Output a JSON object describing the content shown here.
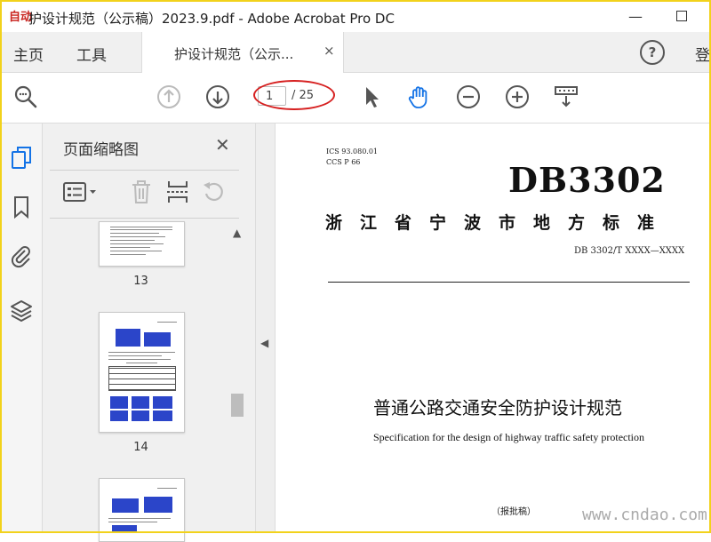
{
  "window": {
    "app_logo": "自动",
    "title": "护设计规范（公示稿）2023.9.pdf - Adobe Acrobat Pro DC",
    "minimize": "—"
  },
  "menu": {
    "home": "主页",
    "tools": "工具",
    "doc_tab": "护设计规范（公示...",
    "doc_tab_close": "×",
    "help": "?",
    "signin": "登"
  },
  "toolbar": {
    "page_current": "1",
    "page_total": "/ 25",
    "icons": [
      "zoom-search-icon",
      "page-up-icon",
      "page-down-icon",
      "select-arrow-icon",
      "hand-icon",
      "zoom-out-icon",
      "zoom-in-icon",
      "scroll-mode-icon"
    ]
  },
  "panel": {
    "title": "页面缩略图",
    "close": "✕",
    "thumbnails": [
      {
        "page": "13"
      },
      {
        "page": "14"
      },
      {
        "page": ""
      }
    ]
  },
  "document": {
    "ics": "ICS  93.080.01",
    "ccs": "CCS  P  66",
    "code": "DB3302",
    "province": "浙江省宁波市地方标准",
    "std_no": "DB 3302/T  XXXX—XXXX",
    "title_cn": "普通公路交通安全防护设计规范",
    "title_en": "Specification for the design of highway traffic safety protection",
    "draft": "（报批稿）"
  },
  "watermark": "www.cndao.com",
  "colors": {
    "accent_blue": "#1473e6",
    "annotation_red": "#d62020",
    "frame_yellow": "#f2d21b"
  }
}
